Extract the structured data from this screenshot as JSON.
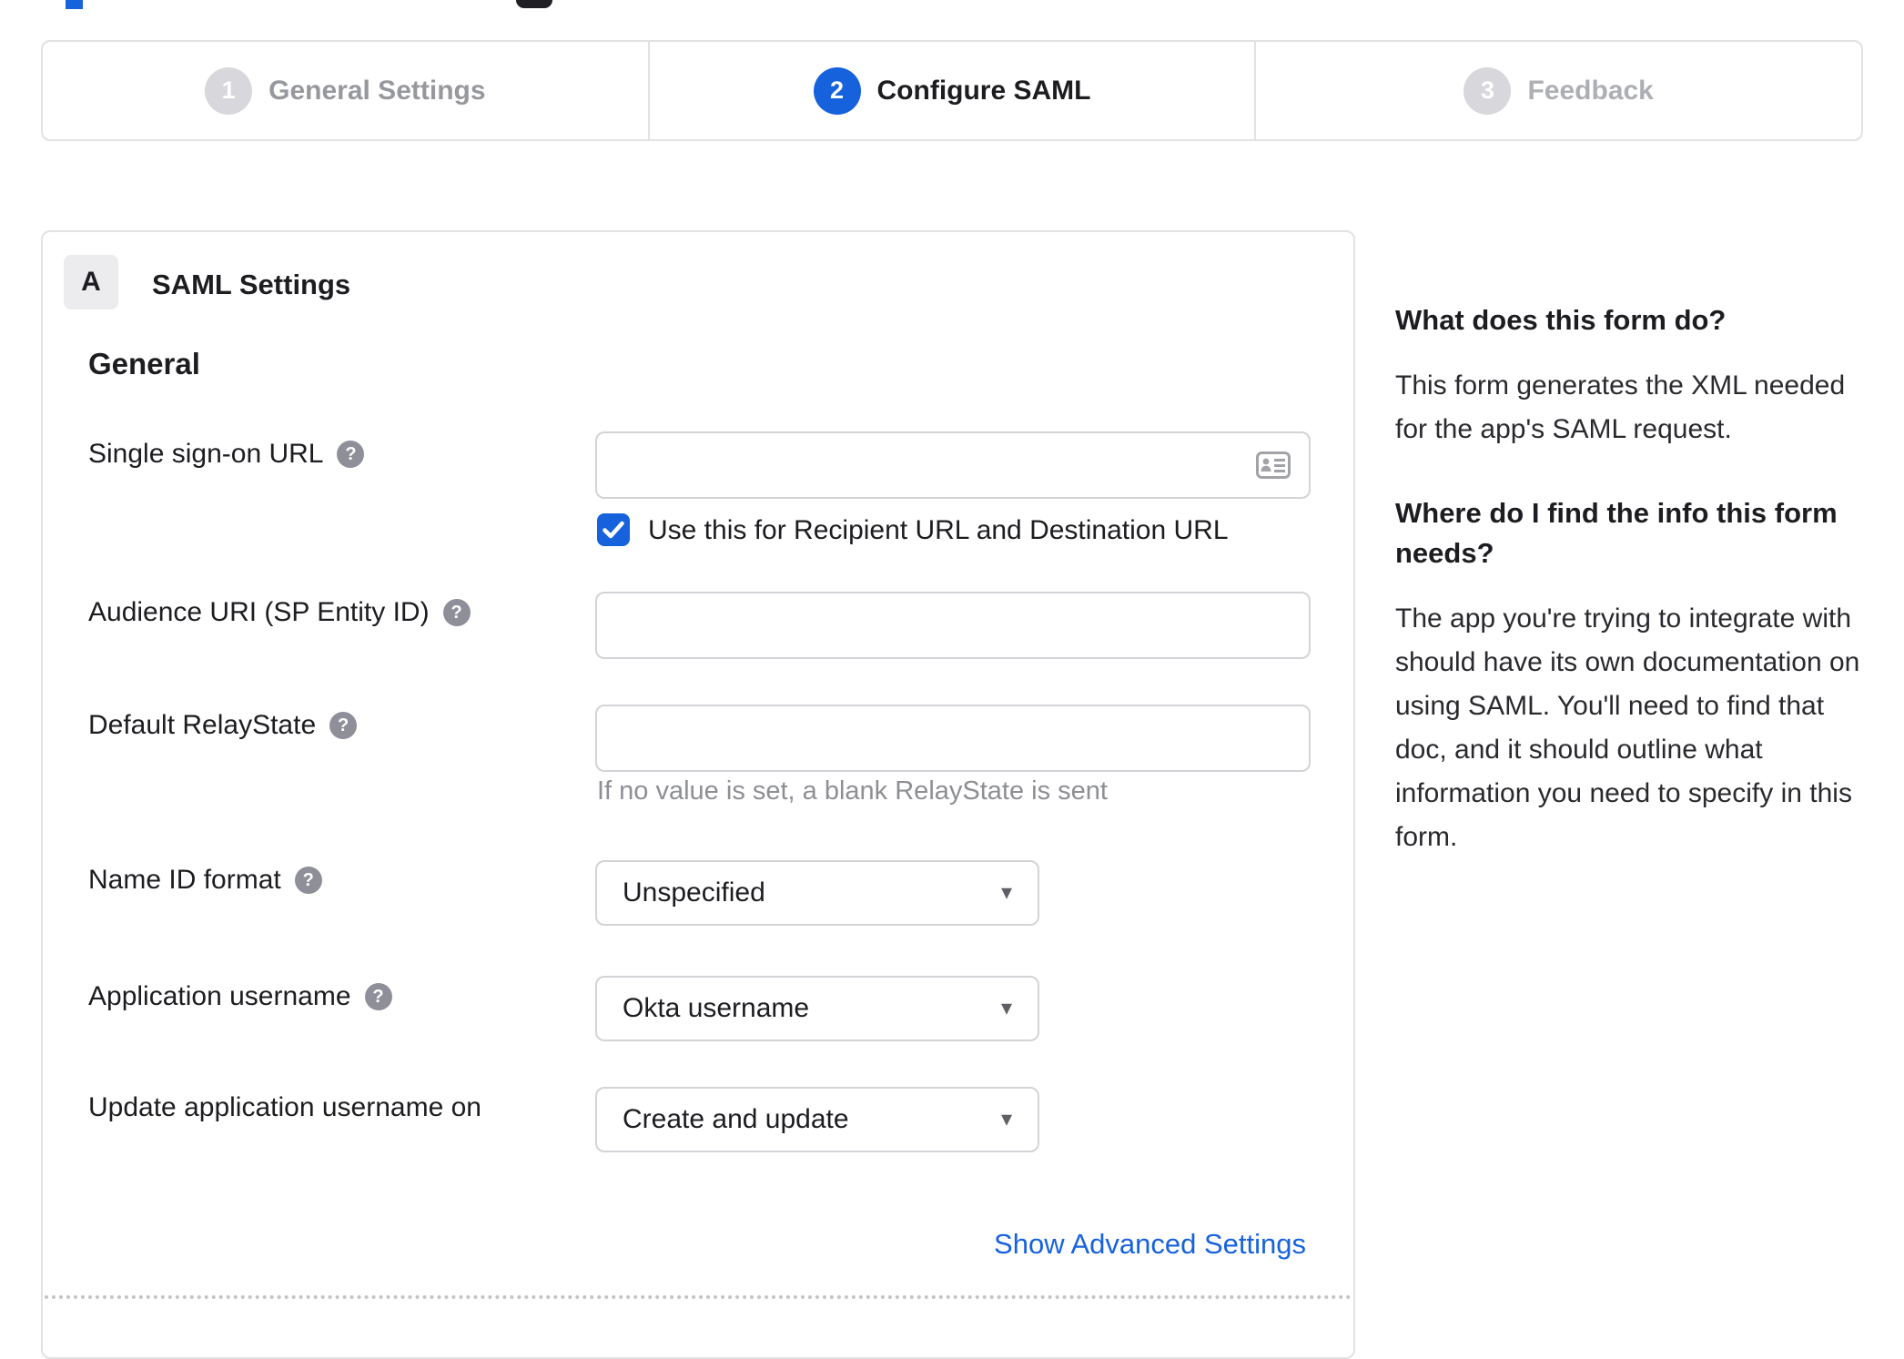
{
  "stepper": {
    "steps": [
      {
        "number": "1",
        "label": "General Settings",
        "active": false
      },
      {
        "number": "2",
        "label": "Configure SAML",
        "active": true
      },
      {
        "number": "3",
        "label": "Feedback",
        "active": false
      }
    ]
  },
  "panel": {
    "badge": "A",
    "title": "SAML Settings",
    "group_heading": "General",
    "fields": [
      {
        "label": "Single sign-on URL",
        "value": "",
        "checkbox_label": "Use this for Recipient URL and Destination URL",
        "checkbox_checked": true
      },
      {
        "label": "Audience URI (SP Entity ID)",
        "value": ""
      },
      {
        "label": "Default RelayState",
        "value": "",
        "hint": "If no value is set, a blank RelayState is sent"
      },
      {
        "label": "Name ID format",
        "value": "Unspecified"
      },
      {
        "label": "Application username",
        "value": "Okta username"
      },
      {
        "label": "Update application username on",
        "value": "Create and update"
      }
    ],
    "advanced_link": "Show Advanced Settings"
  },
  "sidebar": {
    "sections": [
      {
        "heading": "What does this form do?",
        "body": "This form generates the XML needed for the app's SAML request."
      },
      {
        "heading": "Where do I find the info this form needs?",
        "body": "The app you're trying to integrate with should have its own documentation on using SAML. You'll need to find that doc, and it should outline what information you need to specify in this form."
      }
    ]
  },
  "icons": {
    "help_glyph": "?",
    "caret_glyph": "▾",
    "input_icon": "contact-card-icon",
    "checkbox_icon": "checkmark-icon"
  },
  "colors": {
    "accent_blue": "#1662dd",
    "inactive_step_gray": "#d8d8dc",
    "border_gray": "#e2e2e4",
    "hint_gray": "#8e8f94"
  }
}
